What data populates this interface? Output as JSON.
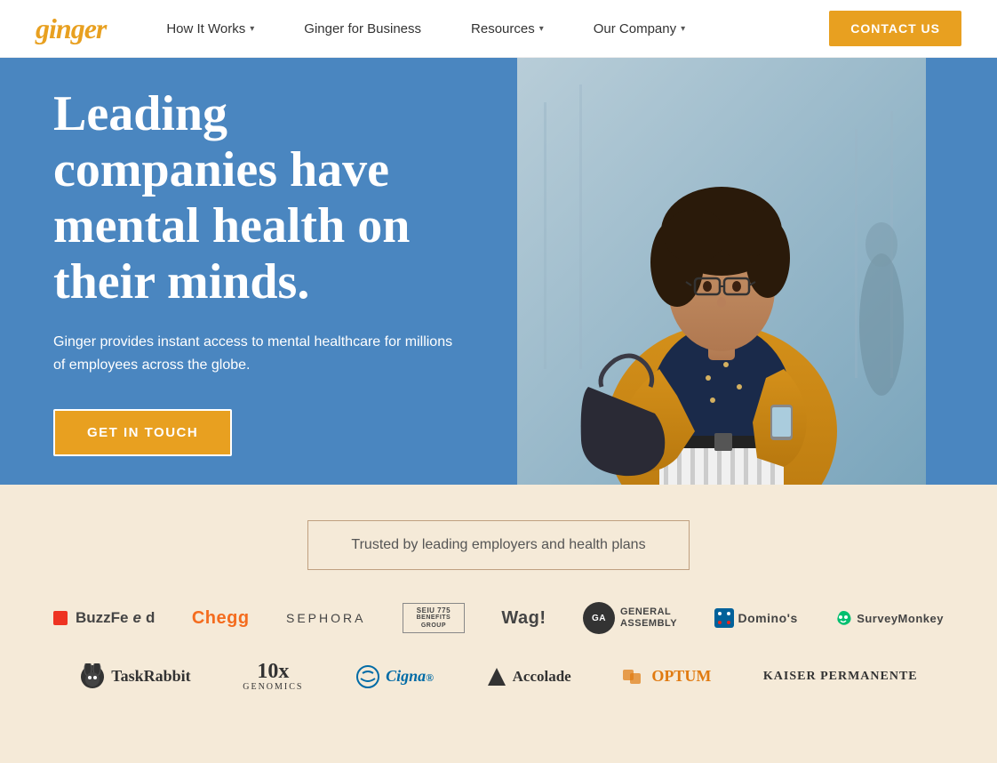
{
  "nav": {
    "logo": "ginger",
    "items": [
      {
        "label": "How It Works",
        "hasDropdown": true
      },
      {
        "label": "Ginger for Business",
        "hasDropdown": false
      },
      {
        "label": "Resources",
        "hasDropdown": true
      },
      {
        "label": "Our Company",
        "hasDropdown": true
      }
    ],
    "cta_label": "CONTACT US"
  },
  "hero": {
    "title": "Leading companies have mental health on their minds.",
    "subtitle": "Ginger provides instant access to mental healthcare for millions of employees across the globe.",
    "cta_label": "GET IN TOUCH"
  },
  "trusted": {
    "banner_text": "Trusted by leading employers and health plans",
    "logos_row1": [
      "BuzzFeed",
      "Chegg",
      "SEPHORA",
      "SEIU 775 Benefits Group",
      "Wag!",
      "General Assembly",
      "Domino's",
      "SurveyMonkey"
    ],
    "logos_row2": [
      "TaskRabbit",
      "10x Genomics",
      "Cigna",
      "Accolade",
      "Optum",
      "Kaiser Permanente"
    ]
  },
  "colors": {
    "orange": "#e8a020",
    "hero_bg": "#4a86c0",
    "trusted_bg": "#f5ead8"
  }
}
